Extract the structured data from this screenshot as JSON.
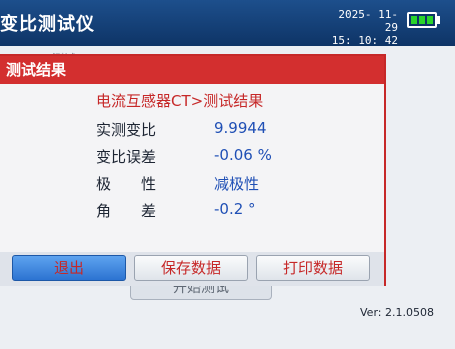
{
  "header": {
    "title": "变比测试仪",
    "date": "2025- 11- 29",
    "time": "15: 10: 42"
  },
  "battery": {
    "level": 1.0,
    "color": "#2ad42a"
  },
  "background_screen": {
    "obscured_text": "…测试…",
    "start_button_label": "开始测试"
  },
  "dialog": {
    "title": "测试结果",
    "subtitle": "电流互感器CT>测试结果",
    "results": [
      {
        "label": "实测变比",
        "value": "9.9944"
      },
      {
        "label": "变比误差",
        "value": "-0.06 %"
      },
      {
        "label": "极　　性",
        "value": "减极性"
      },
      {
        "label": "角　　差",
        "value": "-0.2 °"
      }
    ],
    "buttons": {
      "exit": "退出",
      "save": "保存数据",
      "print": "打印数据"
    }
  },
  "footer": {
    "version": "Ver: 2.1.0508"
  },
  "colors": {
    "accent_red": "#d32f2f",
    "value_blue": "#1f4fb5",
    "header_blue": "#0e3466"
  }
}
